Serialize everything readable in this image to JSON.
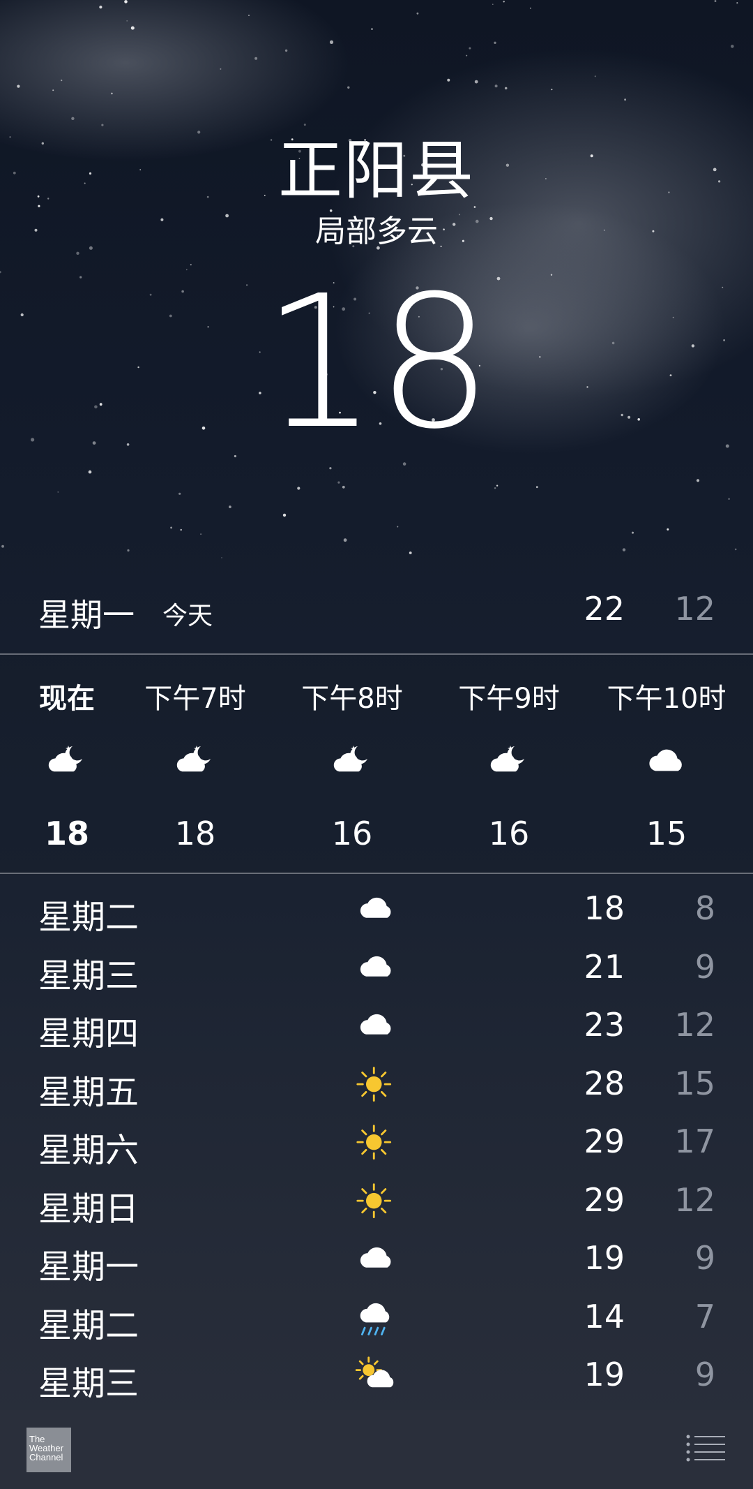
{
  "location": {
    "city": "正阳县",
    "condition": "局部多云",
    "temperature": "18"
  },
  "today": {
    "day": "星期一",
    "label": "今天",
    "high": "22",
    "low": "12"
  },
  "hourly": [
    {
      "label": "现在",
      "icon": "partly-cloudy-night-icon",
      "temp": "18",
      "current": true
    },
    {
      "label": "下午7时",
      "icon": "partly-cloudy-night-icon",
      "temp": "18"
    },
    {
      "label": "下午8时",
      "icon": "partly-cloudy-night-icon",
      "temp": "16"
    },
    {
      "label": "下午9时",
      "icon": "partly-cloudy-night-icon",
      "temp": "16"
    },
    {
      "label": "下午10时",
      "icon": "cloud-icon",
      "temp": "15"
    }
  ],
  "daily": [
    {
      "day": "星期二",
      "icon": "cloud-icon",
      "high": "18",
      "low": "8"
    },
    {
      "day": "星期三",
      "icon": "cloud-icon",
      "high": "21",
      "low": "9"
    },
    {
      "day": "星期四",
      "icon": "cloud-icon",
      "high": "23",
      "low": "12"
    },
    {
      "day": "星期五",
      "icon": "sun-icon",
      "high": "28",
      "low": "15"
    },
    {
      "day": "星期六",
      "icon": "sun-icon",
      "high": "29",
      "low": "17"
    },
    {
      "day": "星期日",
      "icon": "sun-icon",
      "high": "29",
      "low": "12"
    },
    {
      "day": "星期一",
      "icon": "cloud-icon",
      "high": "19",
      "low": "9"
    },
    {
      "day": "星期二",
      "icon": "rain-icon",
      "high": "14",
      "low": "7"
    },
    {
      "day": "星期三",
      "icon": "partly-sunny-icon",
      "high": "19",
      "low": "9"
    }
  ],
  "footer": {
    "brand_line1": "The",
    "brand_line2": "Weather",
    "brand_line3": "Channel"
  },
  "colors": {
    "sun": "#f7c730",
    "rain": "#4fb3f0",
    "low_temp": "#8f95a1"
  }
}
